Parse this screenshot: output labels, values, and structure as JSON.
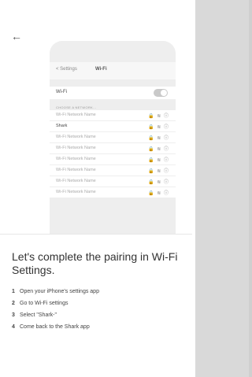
{
  "nav": {
    "back_icon": "←"
  },
  "phone": {
    "header_back": "< Settings",
    "header_title": "Wi-Fi",
    "wifi_label": "Wi-Fi",
    "section_label": "CHOOSE A NETWORK...",
    "networks": [
      {
        "name": "Wi-Fi Network Name"
      },
      {
        "name": "Shark"
      },
      {
        "name": "Wi-Fi Network Name"
      },
      {
        "name": "Wi-Fi Network Name"
      },
      {
        "name": "Wi-Fi Network Name"
      },
      {
        "name": "Wi-Fi Network Name"
      },
      {
        "name": "Wi-Fi Network Name"
      },
      {
        "name": "Wi-Fi Network Name"
      }
    ],
    "network_icons": "🔒 ≋ ⓘ"
  },
  "instructions": {
    "heading": "Let's complete the pairing in Wi-Fi Settings.",
    "steps": [
      {
        "num": "1",
        "text": "Open your iPhone's settings app"
      },
      {
        "num": "2",
        "text": "Go to Wi-Fi settings"
      },
      {
        "num": "3",
        "text": "Select \"Shark-\""
      },
      {
        "num": "4",
        "text": "Come back to the Shark app"
      }
    ]
  }
}
